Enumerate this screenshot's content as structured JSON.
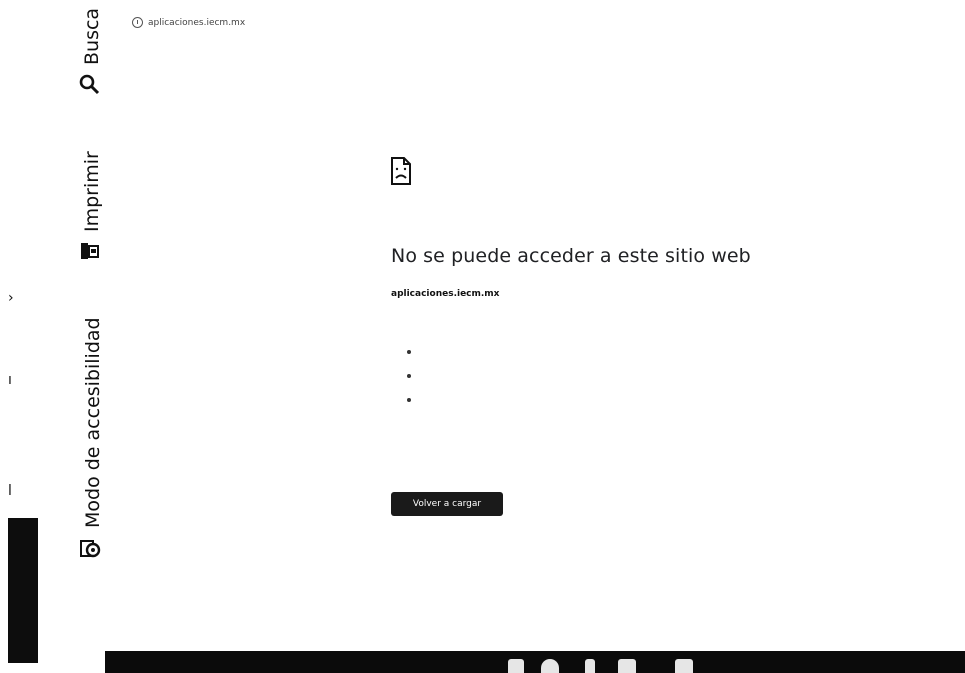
{
  "toolbar": {
    "search_label": "Busca",
    "print_label": "Imprimir",
    "accessibility_label": "Modo de accesibilidad"
  },
  "edge_marks": [
    "›",
    "ı",
    "l"
  ],
  "address_bar": {
    "url": "aplicaciones.iecm.mx"
  },
  "error_page": {
    "title": "No se puede acceder a este sitio web",
    "host": "aplicaciones.iecm.mx",
    "reload_label": "Volver a cargar"
  }
}
